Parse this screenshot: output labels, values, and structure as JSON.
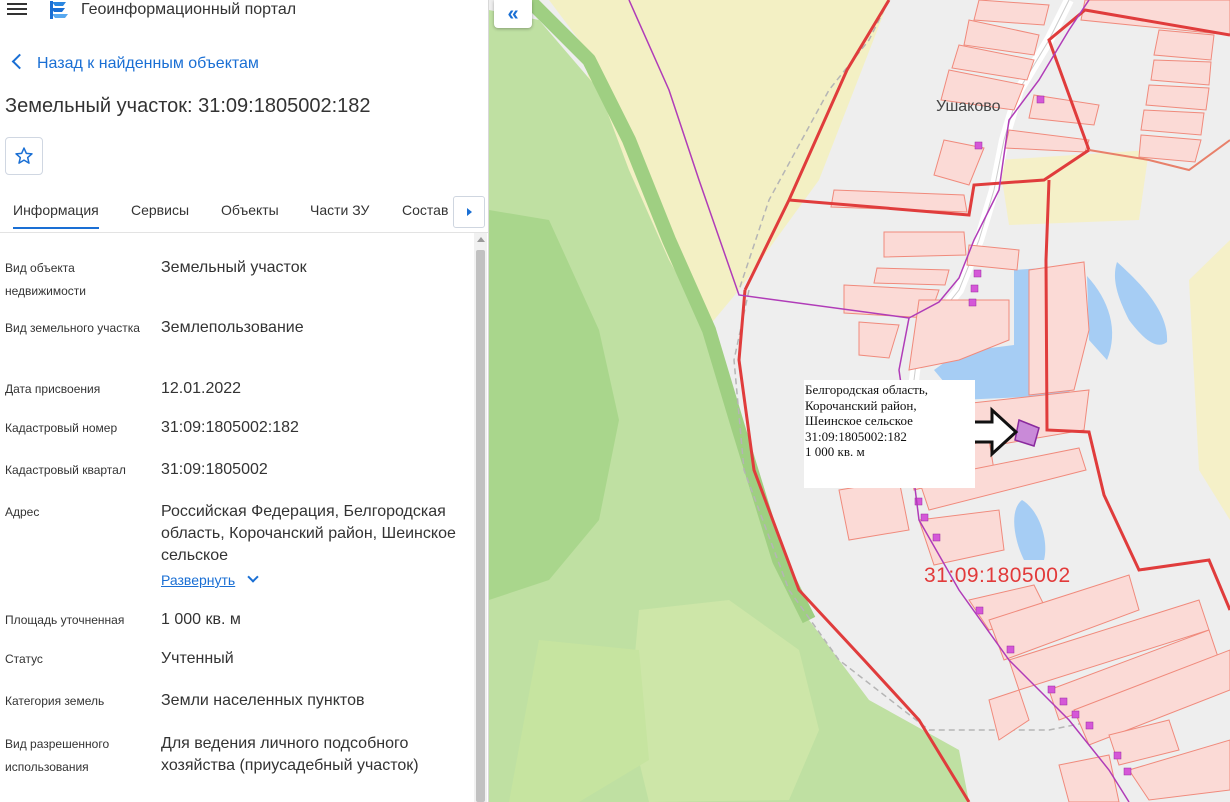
{
  "app": {
    "title": "Геоинформационный портал",
    "menu_icon": "hamburger-icon",
    "logo_icon": "portal-logo-icon"
  },
  "back": {
    "label": "Назад к найденным объектам"
  },
  "object": {
    "title": "Земельный участок: 31:09:1805002:182"
  },
  "tabs": [
    {
      "label": "Информация",
      "active": true
    },
    {
      "label": "Сервисы"
    },
    {
      "label": "Объекты"
    },
    {
      "label": "Части ЗУ"
    },
    {
      "label": "Состав"
    }
  ],
  "properties": [
    {
      "label": "Вид объекта недвижимости",
      "value": "Земельный участок"
    },
    {
      "label": "Вид земельного участка",
      "value": "Землепользование"
    },
    {
      "label": "Дата присвоения",
      "value": "12.01.2022"
    },
    {
      "label": "Кадастровый номер",
      "value": "31:09:1805002:182"
    },
    {
      "label": "Кадастровый квартал",
      "value": "31:09:1805002"
    },
    {
      "label": "Адрес",
      "value": "Российская Федерация, Белгородская область, Корочанский район, Шеинское сельское"
    },
    {
      "label": "Площадь уточненная",
      "value": "1 000 кв. м"
    },
    {
      "label": "Статус",
      "value": "Учтенный"
    },
    {
      "label": "Категория земель",
      "value": "Земли населенных пунктов"
    },
    {
      "label": "Вид разрешенного использования",
      "value": "Для ведения личного подсобного хозяйства (приусадебный участок)"
    }
  ],
  "expand": {
    "label": "Развернуть"
  },
  "map": {
    "collapse_glyph": "«",
    "locality": "Ушаково",
    "quarter_label": "31:09:1805002",
    "popup": {
      "lines": [
        "Белгородская область,",
        "Корочанский район,",
        "Шеинское сельское",
        "31:09:1805002:182",
        "1 000 кв. м"
      ]
    },
    "colors": {
      "forest": "#bde0a0",
      "field": "#f3f0c4",
      "water": "#a6cdf4",
      "parcel_fill": "#fbdad6",
      "parcel_stroke": "#f08a7c",
      "boundary": "#e03c3c",
      "admin_line": "#b03cb8",
      "road": "#ffffff"
    }
  }
}
